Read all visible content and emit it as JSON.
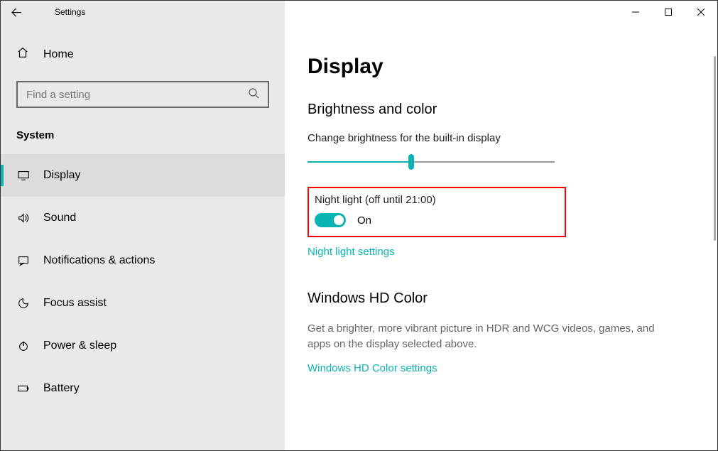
{
  "window": {
    "title": "Settings"
  },
  "sidebar": {
    "home_label": "Home",
    "search_placeholder": "Find a setting",
    "category": "System",
    "items": [
      {
        "label": "Display",
        "icon": "display",
        "active": true
      },
      {
        "label": "Sound",
        "icon": "sound"
      },
      {
        "label": "Notifications & actions",
        "icon": "notifications"
      },
      {
        "label": "Focus assist",
        "icon": "focus"
      },
      {
        "label": "Power & sleep",
        "icon": "power"
      },
      {
        "label": "Battery",
        "icon": "battery"
      }
    ]
  },
  "content": {
    "title": "Display",
    "brightness": {
      "heading": "Brightness and color",
      "slider_label": "Change brightness for the built-in display",
      "night_light_label": "Night light (off until 21:00)",
      "toggle_state": "On",
      "night_light_link": "Night light settings"
    },
    "hdcolor": {
      "heading": "Windows HD Color",
      "desc": "Get a brighter, more vibrant picture in HDR and WCG videos, games, and apps on the display selected above.",
      "link": "Windows HD Color settings"
    }
  }
}
